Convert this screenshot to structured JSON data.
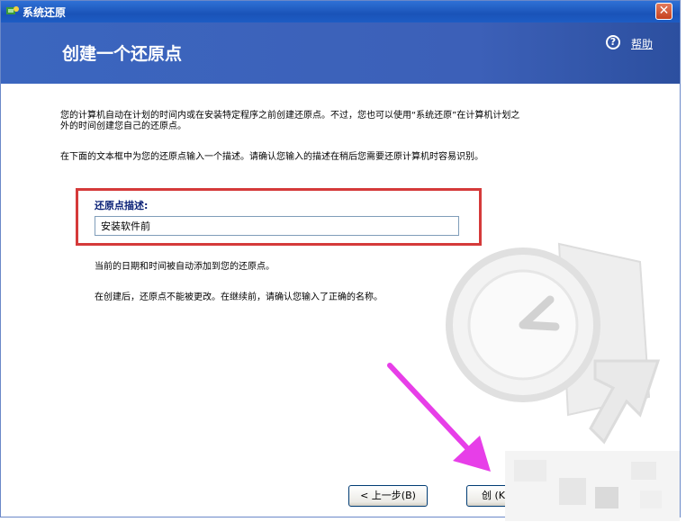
{
  "window": {
    "title": "系统还原",
    "close_glyph": "✕"
  },
  "header": {
    "title": "创建一个还原点",
    "help_glyph": "?",
    "help_label": "帮助"
  },
  "content": {
    "description_1": "您的计算机自动在计划的时间内或在安装特定程序之前创建还原点。不过，您也可以使用“系统还原”在计算机计划之外的时间创建您自己的还原点。",
    "description_2": "在下面的文本框中为您的还原点输入一个描述。请确认您输入的描述在稍后您需要还原计算机时容易识别。",
    "field_label": "还原点描述:",
    "field_value": "安装软件前",
    "note_1": "当前的日期和时间被自动添加到您的还原点。",
    "note_2": "在创建后，还原点不能被更改。在继续前，请确认您输入了正确的名称。"
  },
  "buttons": {
    "back": "< 上一步(B)",
    "create": "创 (K"
  },
  "colors": {
    "header_blue": "#3c60b8",
    "title_bar": "#1a53b8",
    "highlight_red": "#d53a3a",
    "arrow_magenta": "#e73ee8"
  }
}
